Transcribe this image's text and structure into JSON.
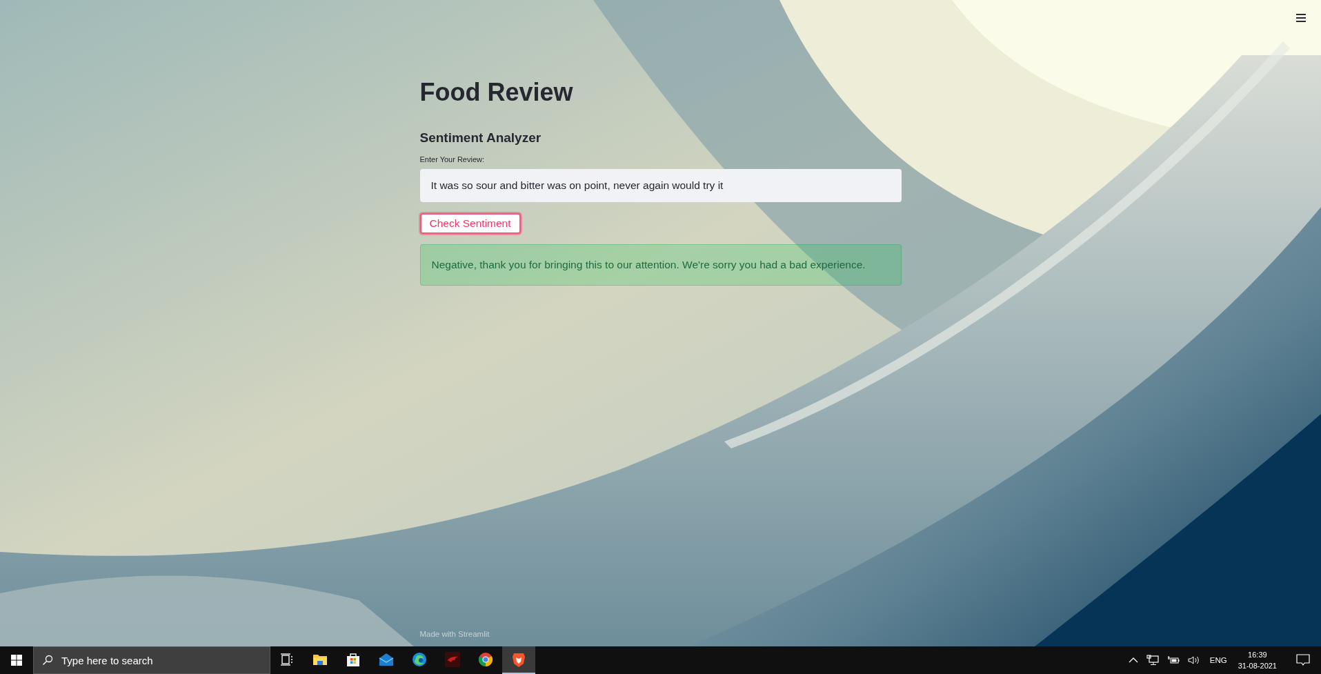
{
  "app": {
    "title": "Food Review",
    "subheader": "Sentiment Analyzer",
    "input": {
      "label": "Enter Your Review:",
      "value": "It was so sour and bitter was on point, never again would try it"
    },
    "button": "Check Sentiment",
    "alert": {
      "kind": "success",
      "text": "Negative, thank you for bringing this to our attention. We're sorry you had a bad experience."
    },
    "footer": "Made with Streamlit"
  },
  "taskbar": {
    "search": {
      "placeholder": "Type here to search"
    },
    "apps": [
      {
        "kind": "taskview",
        "selected": false
      },
      {
        "kind": "folder",
        "selected": false
      },
      {
        "kind": "store",
        "selected": false
      },
      {
        "kind": "mail",
        "selected": false
      },
      {
        "kind": "edge",
        "selected": false
      },
      {
        "kind": "dragon",
        "selected": false
      },
      {
        "kind": "chrome",
        "selected": false
      },
      {
        "kind": "brave",
        "selected": true
      }
    ],
    "tray": {
      "language": "ENG",
      "time": "16:39",
      "date": "31-08-2021"
    }
  }
}
